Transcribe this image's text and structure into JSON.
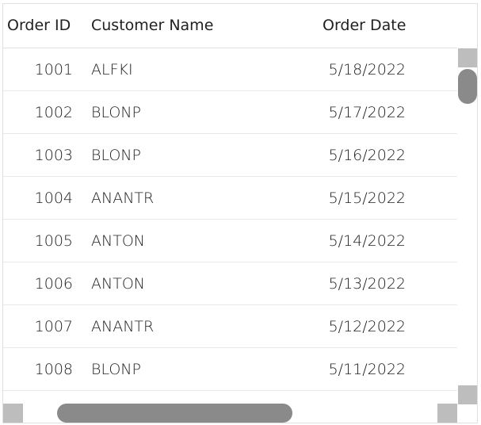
{
  "grid": {
    "columns": {
      "order_id": "Order ID",
      "customer_name": "Customer Name",
      "order_date": "Order Date"
    },
    "rows": [
      {
        "order_id": "1001",
        "customer_name": "ALFKI",
        "order_date": "5/18/2022"
      },
      {
        "order_id": "1002",
        "customer_name": "BLONP",
        "order_date": "5/17/2022"
      },
      {
        "order_id": "1003",
        "customer_name": "BLONP",
        "order_date": "5/16/2022"
      },
      {
        "order_id": "1004",
        "customer_name": "ANANTR",
        "order_date": "5/15/2022"
      },
      {
        "order_id": "1005",
        "customer_name": "ANTON",
        "order_date": "5/14/2022"
      },
      {
        "order_id": "1006",
        "customer_name": "ANTON",
        "order_date": "5/13/2022"
      },
      {
        "order_id": "1007",
        "customer_name": "ANANTR",
        "order_date": "5/12/2022"
      },
      {
        "order_id": "1008",
        "customer_name": "BLONP",
        "order_date": "5/11/2022"
      }
    ]
  },
  "colors": {
    "border": "#e0e0e0",
    "scrollbar_thumb": "#8a8a8a",
    "scrollbar_button": "#bdbdbd",
    "text": "#212121"
  }
}
